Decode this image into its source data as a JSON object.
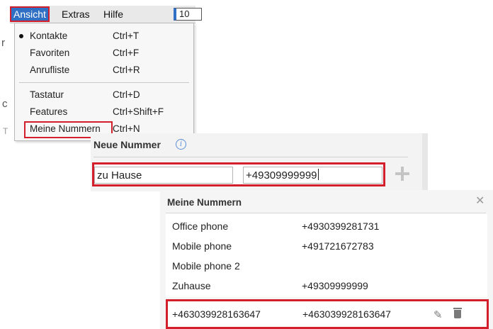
{
  "menubar": {
    "items": [
      "Ansicht",
      "Extras",
      "Hilfe"
    ],
    "field_value": "10"
  },
  "background": {
    "stub_1": "r",
    "stub_2": "c",
    "stub_3": "T"
  },
  "dropdown": {
    "group1": [
      {
        "label": "Kontakte",
        "shortcut": "Ctrl+T",
        "checked": true
      },
      {
        "label": "Favoriten",
        "shortcut": "Ctrl+F"
      },
      {
        "label": "Anrufliste",
        "shortcut": "Ctrl+R"
      }
    ],
    "group2": [
      {
        "label": "Tastatur",
        "shortcut": "Ctrl+D"
      },
      {
        "label": "Features",
        "shortcut": "Ctrl+Shift+F"
      },
      {
        "label": "Meine Nummern",
        "shortcut": "Ctrl+N"
      }
    ]
  },
  "neue_nummer": {
    "title": "Neue Nummer",
    "info_icon": "i",
    "name_value": "zu Hause",
    "number_value": "+49309999999"
  },
  "meine_nummern": {
    "title": "Meine Nummern",
    "close": "✕",
    "rows": [
      {
        "name": "Office phone",
        "number": "+4930399281731"
      },
      {
        "name": "Mobile phone",
        "number": "+491721672783"
      },
      {
        "name": "Mobile phone 2",
        "number": ""
      },
      {
        "name": "Zuhause",
        "number": "+49309999999"
      }
    ],
    "edit_row": {
      "name": "+463039928163647",
      "number": "+463039928163647"
    }
  },
  "colors": {
    "highlight": "#d21f2b",
    "menu_active": "#2f6fc4"
  }
}
